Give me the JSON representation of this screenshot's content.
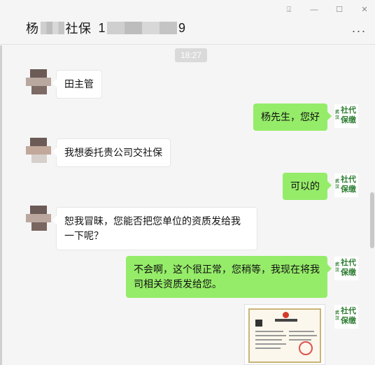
{
  "window": {
    "controls": [
      "⍗",
      "—",
      "☐",
      "✕"
    ]
  },
  "header": {
    "title_part1": "杨",
    "title_part2": "社保",
    "title_part3": "1",
    "title_part4": "9",
    "more": "..."
  },
  "chat": {
    "timestamp": "18:27",
    "messages": [
      {
        "side": "in",
        "text": "田主管"
      },
      {
        "side": "out",
        "text": "杨先生，您好"
      },
      {
        "side": "in",
        "text": "我想委托贵公司交社保"
      },
      {
        "side": "out",
        "text": "可以的"
      },
      {
        "side": "in",
        "text": "恕我冒昧，您能否把您单位的资质发给我一下呢？"
      },
      {
        "side": "out",
        "text": "不会啊，这个很正常，您稍等，我现在将我司相关资质发给您。"
      },
      {
        "side": "out",
        "type": "image",
        "text": "营业执照"
      }
    ],
    "self_avatar": {
      "line1": "社代",
      "line2": "保缴",
      "small": "武汉"
    }
  }
}
